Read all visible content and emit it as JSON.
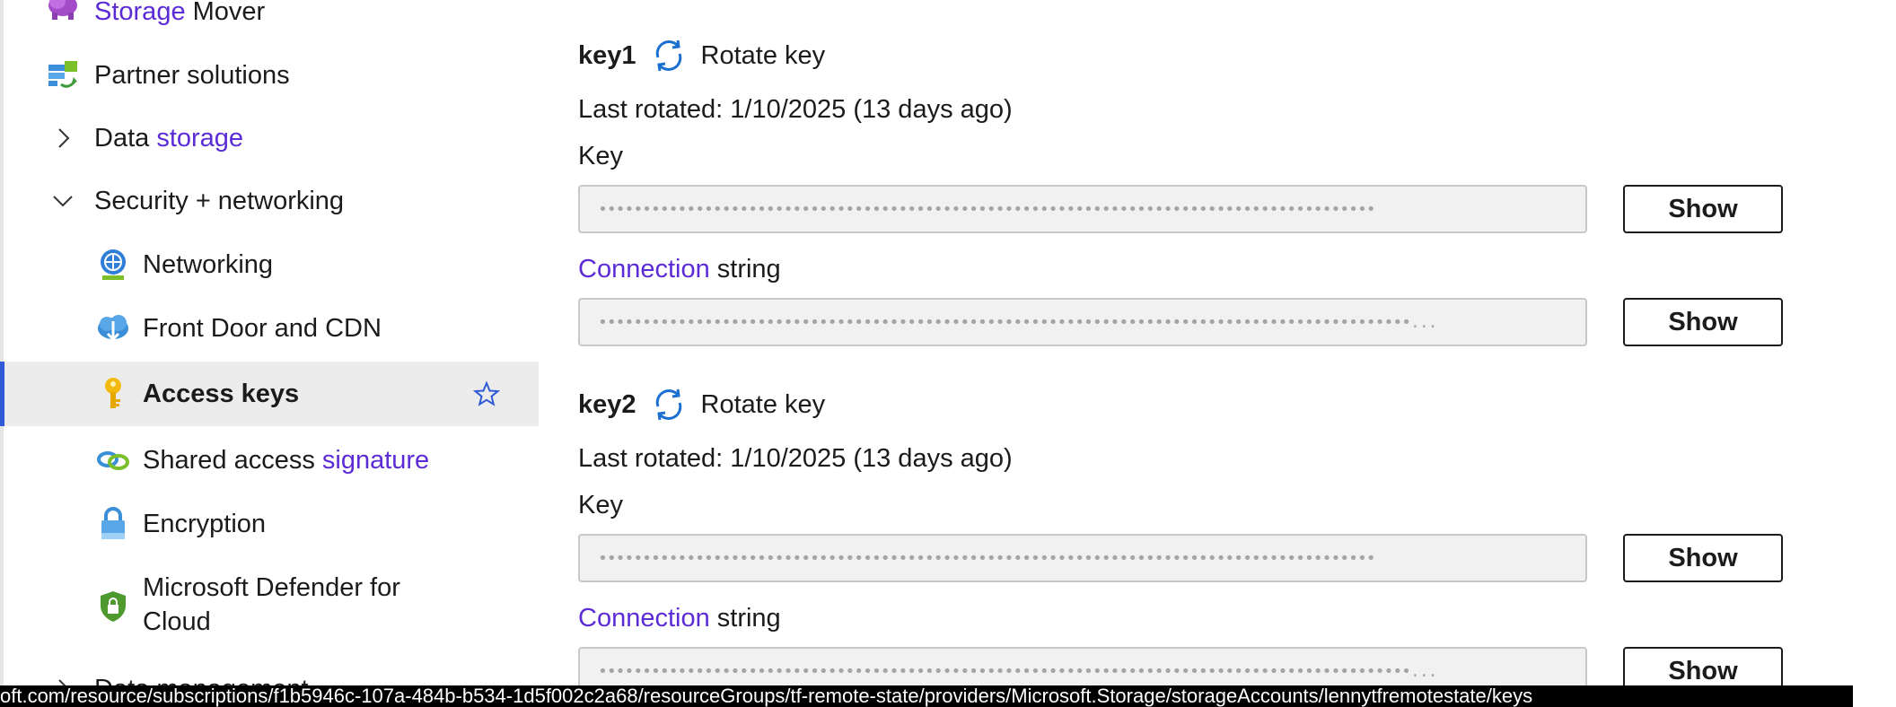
{
  "sidebar": {
    "items": [
      {
        "label_a": "Storage",
        "label_b": " Mover",
        "icon": "storage-mover-icon"
      },
      {
        "label_a": "",
        "label_b": "Partner solutions",
        "icon": "partner-solutions-icon"
      },
      {
        "label_a": "Data ",
        "label_b": "storage",
        "icon": "chevron-right-icon"
      },
      {
        "label_a": "Security + networking",
        "label_b": "",
        "icon": "chevron-down-icon"
      },
      {
        "label_a": "Networking",
        "label_b": "",
        "icon": "networking-icon"
      },
      {
        "label_a": "Front Door and CDN",
        "label_b": "",
        "icon": "front-door-cdn-icon"
      },
      {
        "label_a": "Access keys",
        "label_b": "",
        "icon": "key-icon",
        "active": true
      },
      {
        "label_a": "Shared access ",
        "label_b": "signature",
        "icon": "shared-access-signature-icon"
      },
      {
        "label_a": "Encryption",
        "label_b": "",
        "icon": "encryption-icon"
      },
      {
        "label_a": "Microsoft Defender for",
        "label_b": "Cloud",
        "icon": "defender-shield-icon"
      },
      {
        "label_a": "Data management",
        "label_b": "",
        "icon": "chevron-right-icon"
      }
    ]
  },
  "keys": [
    {
      "name": "key1",
      "rotate_label": "Rotate key",
      "last_rotated": "Last rotated: 1/10/2025 (13 days ago)",
      "key_label": "Key",
      "key_masked": "••••••••••••••••••••••••••••••••••••••••••••••••••••••••••••••••••••••••••••••••••••••••",
      "key_show": "Show",
      "conn_label_a": "Connection",
      "conn_label_b": " string",
      "conn_masked": "••••••••••••••••••••••••••••••••••••••••••••••••••••••••••••••••••••••••••••••••••••••••••••...",
      "conn_show": "Show"
    },
    {
      "name": "key2",
      "rotate_label": "Rotate key",
      "last_rotated": "Last rotated: 1/10/2025 (13 days ago)",
      "key_label": "Key",
      "key_masked": "••••••••••••••••••••••••••••••••••••••••••••••••••••••••••••••••••••••••••••••••••••••••",
      "key_show": "Show",
      "conn_label_a": "Connection",
      "conn_label_b": " string",
      "conn_masked": "••••••••••••••••••••••••••••••••••••••••••••••••••••••••••••••••••••••••••••••••••••••••••••...",
      "conn_show": "Show"
    }
  ],
  "status_bar": {
    "url": "oft.com/resource/subscriptions/f1b5946c-107a-484b-b534-1d5f002c2a68/resourceGroups/tf-remote-state/providers/Microsoft.Storage/storageAccounts/lennytfremotestate/keys"
  },
  "colors": {
    "accent_text": "#5b2bd6",
    "active_indicator": "#2f5bd7",
    "rotate_icon": "#1a6fd0"
  }
}
